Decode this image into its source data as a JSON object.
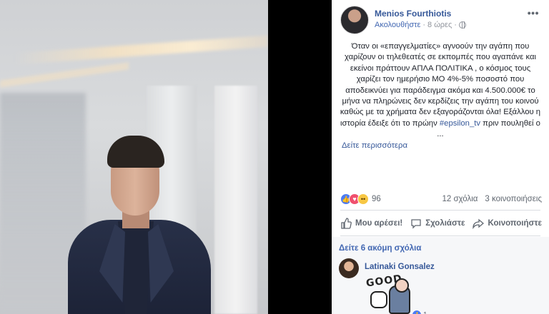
{
  "post": {
    "author_name": "Menios Fourthiotis",
    "follow_label": "Ακολουθήστε",
    "separator": "·",
    "time": "8 ώρες",
    "more_label": "•••",
    "text_main": "Όταν οι «επαγγελματίες» αγνοούν την αγάπη που χαρίζουν οι τηλεθεατές σε εκπομπές που αγαπάνε και εκείνοι πράττουν ΑΠΛΑ ΠΟΛΙΤΙΚΑ , ο κόσμος τους χαρίζει τον ημερήσιο ΜΟ 4%-5% ποσοστό που αποδεικνύει για παράδειγμα ακόμα και 4.500.000€ το μήνα να πληρώνεις δεν κερδίζεις την αγάπη του κοινού καθώς με τα χρήματα δεν εξαγοράζονται όλα! Εξάλλου η ιστορία έδειξε ότι το πρώην ",
    "hashtag": "#epsilon_tv",
    "text_tail": " πριν πουληθεί ο ...",
    "see_more": "Δείτε περισσότερα"
  },
  "reactions": {
    "count": "96",
    "comments": "12 σχόλια",
    "shares": "3 κοινοποιήσεις",
    "icons": [
      "like-icon",
      "love-icon",
      "wow-icon"
    ],
    "colors": {
      "like": "#4c7cf4",
      "love": "#f0506e",
      "wow": "#f7c744"
    }
  },
  "actions": {
    "like": "Μου αρέσει!",
    "comment": "Σχολιάστε",
    "share": "Κοινοποιήστε"
  },
  "comments": {
    "view_more": "Δείτε 6 ακόμη σχόλια",
    "items": [
      {
        "name": "Latinaki Gonsalez",
        "sticker_text": "GOOD",
        "reaction_count": "1"
      }
    ]
  },
  "colors": {
    "link": "#365899",
    "accent": "#4267b2",
    "muted": "#90949c",
    "text": "#1d2129"
  }
}
